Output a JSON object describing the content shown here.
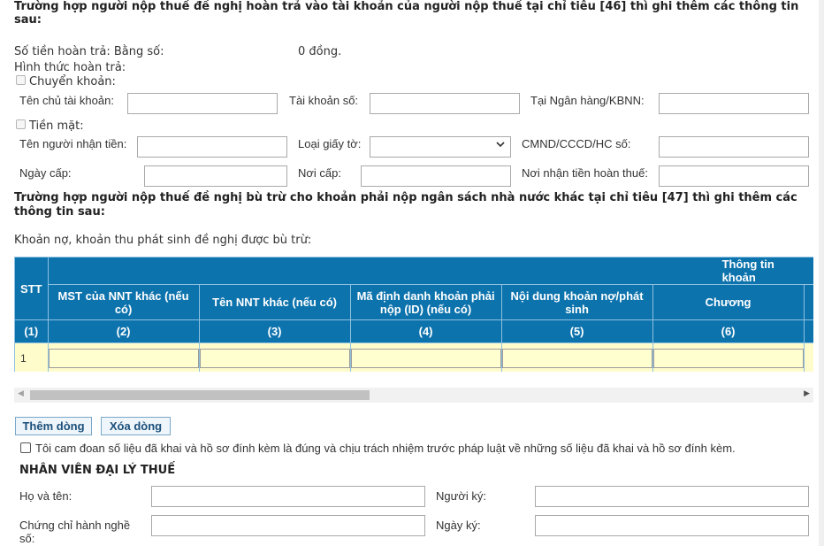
{
  "section46": {
    "heading_line1": "Trường hợp người nộp thuế đề nghị hoàn trả vào tài khoản của người nộp thuế tại chỉ tiêu [46] thì ghi thêm các thông tin",
    "heading_line2": "sau:",
    "refund_amount_label": "Số tiền hoàn trả: Bằng số:",
    "refund_amount_value": "0 đồng.",
    "refund_method_label": "Hình thức hoàn trả:",
    "transfer_label": "Chuyển khoản:",
    "account_holder_label": "Tên chủ tài khoản:",
    "account_number_label": "Tài khoản số:",
    "bank_label": "Tại Ngân hàng/KBNN:",
    "cash_label": "Tiền mặt:",
    "recipient_label": "Tên người nhận tiền:",
    "doc_type_label": "Loại giấy tờ:",
    "id_number_label": "CMND/CCCD/HC số:",
    "issue_date_label": "Ngày cấp:",
    "issue_place_label": "Nơi cấp:",
    "refund_receive_place_label": "Nơi nhận tiền hoàn thuế:"
  },
  "section47": {
    "heading_line1": "Trường hợp người nộp thuế đề nghị bù trừ cho khoản phải nộp ngân sách nhà nước khác tại chỉ tiêu [47] thì ghi thêm các",
    "heading_line2": "thông tin sau:",
    "subtitle": "Khoản nợ, khoản thu phát sinh đề nghị được bù trừ:"
  },
  "table": {
    "group_header": "Thông tin khoản",
    "columns": [
      "STT",
      "MST của NNT khác (nếu có)",
      "Tên NNT khác (nếu có)",
      "Mã định danh khoản phải nộp (ID) (nếu có)",
      "Nội dung khoản nợ/phát sinh",
      "Chương"
    ],
    "column_numbers": [
      "(1)",
      "(2)",
      "(3)",
      "(4)",
      "(5)",
      "(6)"
    ],
    "rows": [
      {
        "stt": "1"
      }
    ]
  },
  "buttons": {
    "add_row": "Thêm dòng",
    "delete_row": "Xóa dòng"
  },
  "commitment": "Tôi cam đoan số liệu đã khai và hồ sơ đính kèm là đúng và chịu trách nhiệm trước pháp luật về những số liệu đã khai và hồ sơ đính kèm.",
  "agent": {
    "heading": "NHÂN VIÊN ĐẠI LÝ THUẾ",
    "fullname_label": "Họ và tên:",
    "signer_label": "Người ký:",
    "cert_label_line1": "Chứng chỉ hành nghề",
    "cert_label_line2": "số:",
    "sign_date_label": "Ngày ký:"
  },
  "icons": {
    "select_arrow": "chevron-down-icon",
    "scroll_left": "triangle-left-icon",
    "scroll_right": "triangle-right-icon"
  },
  "colors": {
    "table_header_bg": "#0d73ad",
    "table_cell_bg": "#fffccb",
    "button_text": "#1a4f7a"
  }
}
